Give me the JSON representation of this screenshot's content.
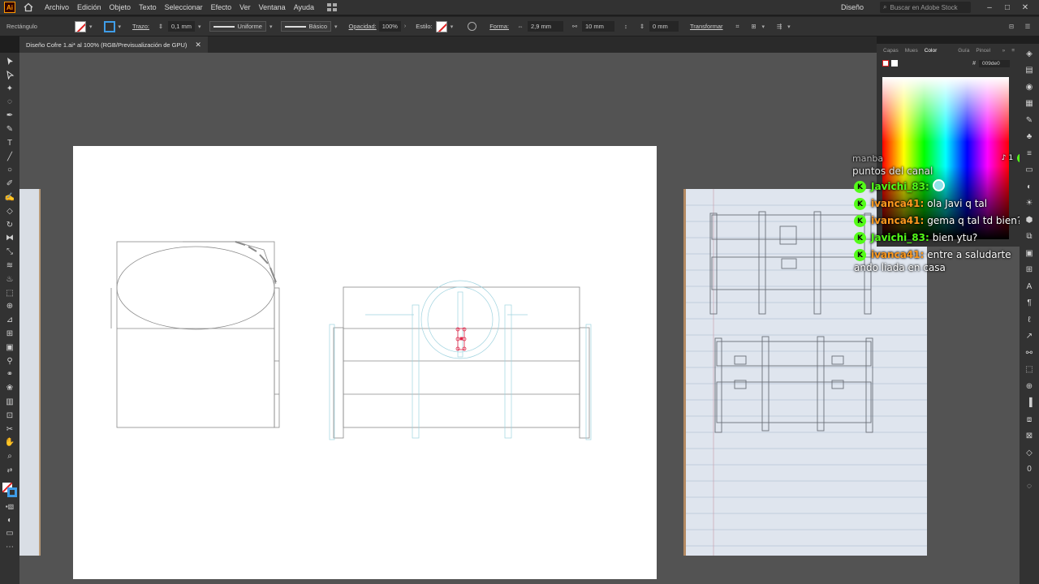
{
  "menubar": {
    "app_logo": "Ai",
    "items": [
      "Archivo",
      "Edición",
      "Objeto",
      "Texto",
      "Seleccionar",
      "Efecto",
      "Ver",
      "Ventana",
      "Ayuda"
    ],
    "workspace": "Diseño",
    "stock_placeholder": "Buscar en Adobe Stock",
    "window_buttons": [
      "–",
      "□",
      "✕"
    ]
  },
  "controlbar": {
    "selection": "Rectángulo",
    "stroke_label": "Trazo:",
    "stroke_value": "0,1 mm",
    "profile": "Uniforme",
    "brush": "Básico",
    "opacity_label": "Opacidad:",
    "opacity_value": "100%",
    "style_label": "Estilo:",
    "shape_label": "Forma:",
    "width_value": "2,9 mm",
    "height_value": "10 mm",
    "angle_value": "0 mm",
    "transform_label": "Transformar",
    "stroke_color": "#3f9de8"
  },
  "document": {
    "tab_title": "Diseño Cofre 1.ai* al 100% (RGB/Previsualización de GPU)",
    "close": "✕"
  },
  "panel": {
    "tabs": [
      "Capas",
      "Mues",
      "Color",
      "Guía",
      "Pincel"
    ],
    "active_tab": "Color",
    "hex_value": "009de0"
  },
  "chat": {
    "top_text": "manba",
    "channel_points": "puntos del canal",
    "stats": {
      "tiktok": "1",
      "kick": "4"
    },
    "messages": [
      {
        "user": "Javichi_83:",
        "color": "#53fc18",
        "text": "",
        "emote": true
      },
      {
        "user": "ivanca41:",
        "color": "#ff9a1f",
        "text": "ola Javi q tal"
      },
      {
        "user": "ivanca41:",
        "color": "#ff9a1f",
        "text": "gema q tal td bien?"
      },
      {
        "user": "Javichi_83:",
        "color": "#53fc18",
        "text": "bien ytu?"
      },
      {
        "user": "ivanca41:",
        "color": "#ff9a1f",
        "text": "entre a saludarte",
        "cont": "ando liada en casa"
      }
    ]
  }
}
